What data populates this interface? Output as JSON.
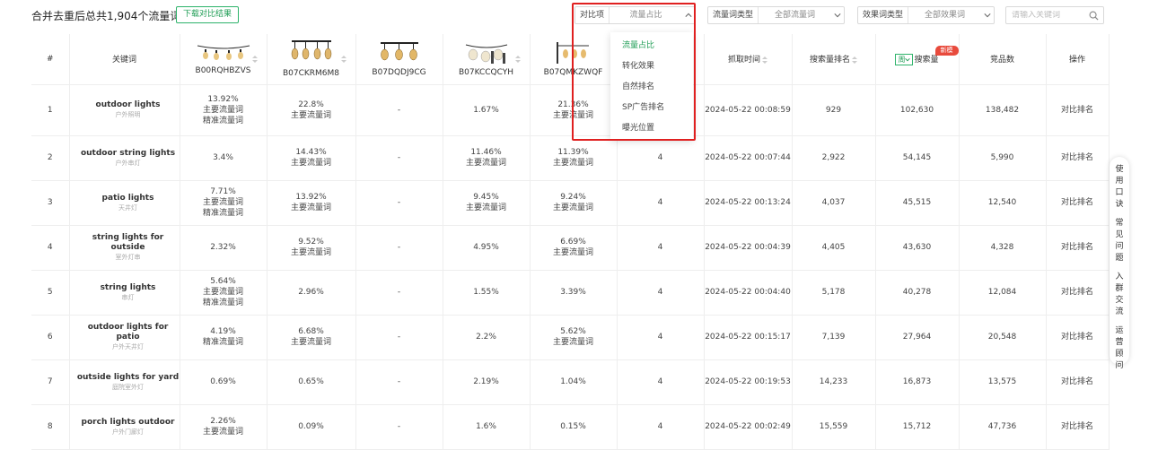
{
  "summary": "合并去重后总共1,904个流量词",
  "download_label": "下载对比结果",
  "filters": {
    "compare": {
      "label": "对比项",
      "value": "流量占比"
    },
    "traffic_type": {
      "label": "流量词类型",
      "value": "全部流量词"
    },
    "effect_type": {
      "label": "效果词类型",
      "value": "全部效果词"
    }
  },
  "search": {
    "placeholder": "请输入关键词"
  },
  "dropdown": {
    "options": [
      "流量占比",
      "转化效果",
      "自然排名",
      "SP广告排名",
      "曝光位置"
    ],
    "selected_index": 0
  },
  "columns": {
    "index": "#",
    "keyword": "关键词",
    "asins": [
      "B00RQHBZVS",
      "B07CKRM6M8",
      "B07DQDJ9CG",
      "B07KCCQCYH",
      "B07QMKZWQF"
    ],
    "crawl_time": "抓取时间",
    "search_rank": "搜索量排名",
    "week": "周",
    "search_volume": "搜索量",
    "new_badge": "新模型",
    "competitors": "竞品数",
    "action": "操作"
  },
  "rows": [
    {
      "i": "1",
      "en": "outdoor lights",
      "cn": "户外照明",
      "c": [
        [
          "13.92%",
          "主要流量词",
          "精准流量词"
        ],
        [
          "22.8%",
          "主要流量词"
        ],
        [
          "-"
        ],
        [
          "1.67%"
        ],
        [
          "21.36%",
          "主要流量词"
        ]
      ],
      "k6": "",
      "time": "2024-05-22 00:08:59",
      "rank": "929",
      "vol": "102,630",
      "comp": "138,482",
      "act": "对比排名"
    },
    {
      "i": "2",
      "en": "outdoor string lights",
      "cn": "户外串灯",
      "c": [
        [
          "3.4%"
        ],
        [
          "14.43%",
          "主要流量词"
        ],
        [
          "-"
        ],
        [
          "11.46%",
          "主要流量词"
        ],
        [
          "11.39%",
          "主要流量词"
        ]
      ],
      "k6": "4",
      "time": "2024-05-22 00:07:44",
      "rank": "2,922",
      "vol": "54,145",
      "comp": "5,990",
      "act": "对比排名"
    },
    {
      "i": "3",
      "en": "patio lights",
      "cn": "天井灯",
      "c": [
        [
          "7.71%",
          "主要流量词",
          "精准流量词"
        ],
        [
          "13.92%",
          "主要流量词"
        ],
        [
          "-"
        ],
        [
          "9.45%",
          "主要流量词"
        ],
        [
          "9.24%",
          "主要流量词"
        ]
      ],
      "k6": "4",
      "time": "2024-05-22 00:13:24",
      "rank": "4,037",
      "vol": "45,515",
      "comp": "12,540",
      "act": "对比排名"
    },
    {
      "i": "4",
      "en": "string lights for outside",
      "cn": "室外灯串",
      "c": [
        [
          "2.32%"
        ],
        [
          "9.52%",
          "主要流量词"
        ],
        [
          "-"
        ],
        [
          "4.95%"
        ],
        [
          "6.69%",
          "主要流量词"
        ]
      ],
      "k6": "4",
      "time": "2024-05-22 00:04:39",
      "rank": "4,405",
      "vol": "43,630",
      "comp": "4,328",
      "act": "对比排名"
    },
    {
      "i": "5",
      "en": "string lights",
      "cn": "串灯",
      "c": [
        [
          "5.64%",
          "主要流量词",
          "精准流量词"
        ],
        [
          "2.96%"
        ],
        [
          "-"
        ],
        [
          "1.55%"
        ],
        [
          "3.39%"
        ]
      ],
      "k6": "4",
      "time": "2024-05-22 00:04:40",
      "rank": "5,178",
      "vol": "40,278",
      "comp": "12,084",
      "act": "对比排名"
    },
    {
      "i": "6",
      "en": "outdoor lights for patio",
      "cn": "户外天井灯",
      "c": [
        [
          "4.19%",
          "精准流量词"
        ],
        [
          "6.68%",
          "主要流量词"
        ],
        [
          "-"
        ],
        [
          "2.2%"
        ],
        [
          "5.62%",
          "主要流量词"
        ]
      ],
      "k6": "4",
      "time": "2024-05-22 00:15:17",
      "rank": "7,139",
      "vol": "27,964",
      "comp": "20,548",
      "act": "对比排名"
    },
    {
      "i": "7",
      "en": "outside lights for yard",
      "cn": "庭院室外灯",
      "c": [
        [
          "0.69%"
        ],
        [
          "0.65%"
        ],
        [
          "-"
        ],
        [
          "2.19%"
        ],
        [
          "1.04%"
        ]
      ],
      "k6": "4",
      "time": "2024-05-22 00:19:53",
      "rank": "14,233",
      "vol": "16,873",
      "comp": "13,575",
      "act": "对比排名"
    },
    {
      "i": "8",
      "en": "porch lights outdoor",
      "cn": "户外门廊灯",
      "c": [
        [
          "2.26%",
          "主要流量词"
        ],
        [
          "0.09%"
        ],
        [
          "-"
        ],
        [
          "1.6%"
        ],
        [
          "0.15%"
        ]
      ],
      "k6": "4",
      "time": "2024-05-22 00:02:49",
      "rank": "15,559",
      "vol": "15,712",
      "comp": "47,736",
      "act": "对比排名"
    }
  ],
  "side_float": [
    "使用口诀",
    "常见问题",
    "入群交流",
    "运营顾问"
  ],
  "colors": {
    "accent": "#1f9d55",
    "highlight_border": "#e02020",
    "badge": "#e84a3c"
  }
}
